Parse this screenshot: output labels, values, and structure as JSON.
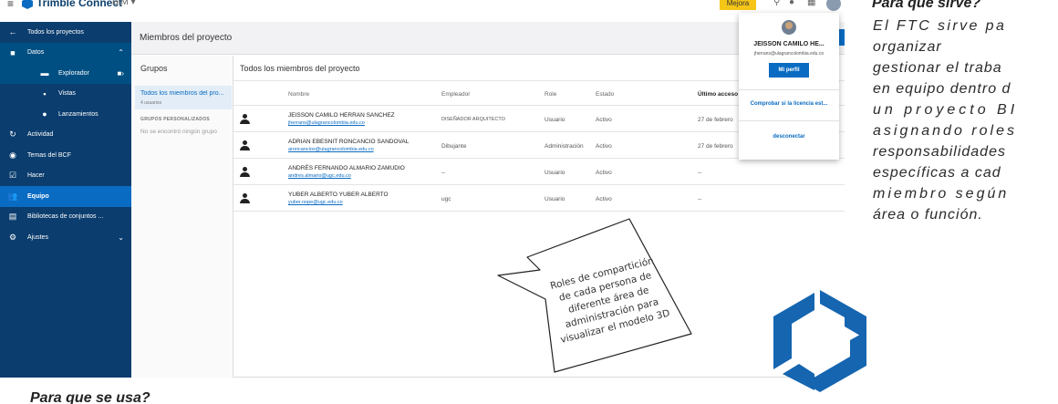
{
  "topbar": {
    "brand": "Trimble Connect",
    "project": "BIM",
    "mejora_label": "Mejora"
  },
  "sidebar": {
    "items": [
      {
        "label": "Todos los proyectos",
        "icon": "arrow-left-icon"
      },
      {
        "label": "Datos",
        "icon": "folder-icon"
      },
      {
        "label": "Explorador",
        "icon": "explorer-icon"
      },
      {
        "label": "Vistas",
        "icon": "views-icon"
      },
      {
        "label": "Lanzamientos",
        "icon": "releases-icon"
      },
      {
        "label": "Actividad",
        "icon": "activity-icon"
      },
      {
        "label": "Temas del BCF",
        "icon": "bcf-icon"
      },
      {
        "label": "Hacer",
        "icon": "checkbox-icon"
      },
      {
        "label": "Equipo",
        "icon": "team-icon"
      },
      {
        "label": "Bibliotecas de conjuntos ...",
        "icon": "library-icon"
      },
      {
        "label": "Ajustes",
        "icon": "gear-icon"
      }
    ]
  },
  "main": {
    "title": "Miembros del proyecto"
  },
  "groups": {
    "title": "Grupos",
    "selected_label": "Todos los miembros del pro...",
    "selected_count": "4 usuarios",
    "custom_caption": "GRUPOS PERSONALIZADOS",
    "empty_text": "No se encontró ningún grupo"
  },
  "members": {
    "title": "Todos los miembros del proyecto",
    "columns": [
      "Nombre",
      "Empleador",
      "Role",
      "Estado",
      "Último acceso"
    ],
    "rows": [
      {
        "name": "JEISSON CAMILO HERRAN SANCHEZ",
        "email": "jherrans@ulagrancolombia.edu.co",
        "employer": "DISEÑADOR ARQUITECTO",
        "role": "Usuario",
        "status": "Activo",
        "last": "27 de febrero"
      },
      {
        "name": "ADRIAN EBESNIT RONCANCIO SANDOVAL",
        "email": "aroncancios@ulagrancolombia.edu.co",
        "employer": "Dibujante",
        "role": "Administración",
        "status": "Activo",
        "last": "27 de febrero"
      },
      {
        "name": "ANDRÉS FERNANDO ALMARIO ZAMUDIO",
        "email": "andres.almario@ugc.edu.co",
        "employer": "--",
        "role": "Usuario",
        "status": "Activo",
        "last": "--"
      },
      {
        "name": "YUBER ALBERTO YUBER ALBERTO",
        "email": "yuber.nope@ugc.edu.co",
        "employer": "ugc",
        "role": "Usuario",
        "status": "Activo",
        "last": "--"
      }
    ]
  },
  "dropdown": {
    "name": "JEISSON CAMILO HE...",
    "email": "jherrans@ulagrancolombia.edu.co",
    "profile_button": "Mi perfil",
    "license_link": "Comprobar si la licencia est...",
    "logout_link": "desconectar"
  },
  "bubble": {
    "lines": [
      "Roles de compartición",
      "de cada persona de",
      "diferente área de",
      "administración para",
      "visualizar el modelo 3D"
    ]
  },
  "right": {
    "heading": "Para que sirve?",
    "lines": [
      "El FTC sirve pa",
      "organizar",
      "gestionar el traba",
      "en equipo dentro d",
      "un proyecto BI",
      "asignando roles",
      "responsabilidades",
      "específicas a cad",
      "miembro según",
      "área o función."
    ]
  },
  "bottom_heading": "Para que se usa?",
  "colors": {
    "sidebar": "#0b3d6e",
    "accent": "#0a6bc2",
    "mejora": "#f5c518",
    "logo": "#1565b0"
  }
}
